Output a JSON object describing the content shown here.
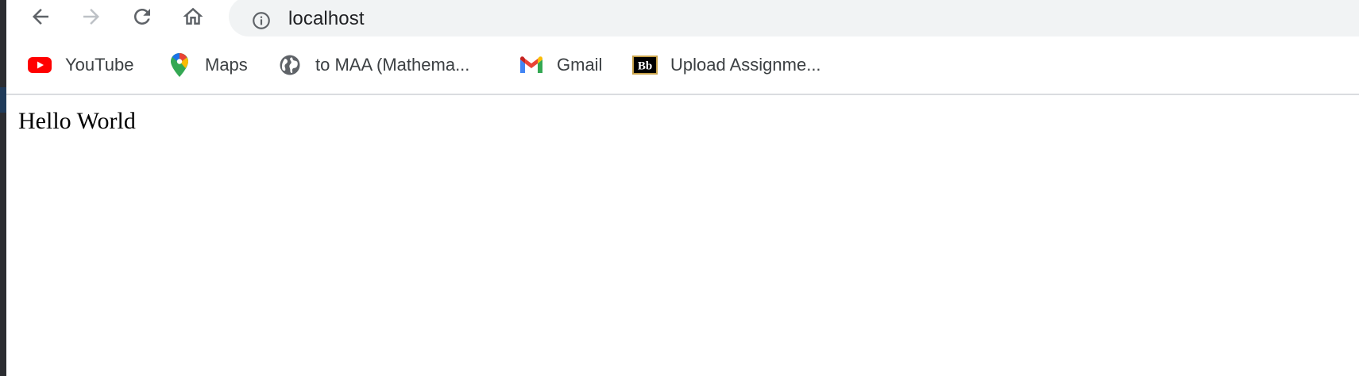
{
  "toolbar": {
    "url": "localhost"
  },
  "bookmarks": [
    {
      "label": "YouTube",
      "icon": "youtube-icon"
    },
    {
      "label": "Maps",
      "icon": "maps-pin-icon"
    },
    {
      "label": "to MAA (Mathema...",
      "icon": "globe-icon"
    },
    {
      "label": "Gmail",
      "icon": "gmail-icon"
    },
    {
      "label": "Upload Assignme...",
      "icon": "blackboard-icon"
    }
  ],
  "page": {
    "text": "Hello World"
  },
  "colors": {
    "omnibox_bg": "#f1f3f4",
    "youtube_red": "#ff0000",
    "text_primary": "#202124",
    "bookmark_text": "#3c4043",
    "divider": "#dadce0"
  }
}
